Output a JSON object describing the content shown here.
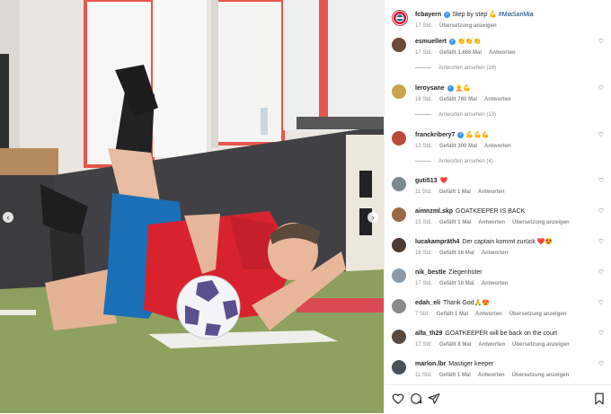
{
  "caption": {
    "username": "fcbayern",
    "text": "Step by step ",
    "emoji": "💪",
    "hashtag": "#MiaSanMia",
    "time": "17 Std.",
    "translate": "Übersetzung anzeigen"
  },
  "comments": [
    {
      "username": "esmuellert",
      "verified": true,
      "text": "",
      "emoji": "👏👏👏",
      "time": "17 Std.",
      "likes": "Gefällt 1.666 Mal",
      "reply": "Antworten",
      "translate": "",
      "replies": "Antworten ansehen (18)"
    },
    {
      "username": "leroysane",
      "verified": true,
      "text": "",
      "emoji": "🧑‍🦲💪",
      "time": "16 Std.",
      "likes": "Gefällt 760 Mal",
      "reply": "Antworten",
      "translate": "",
      "replies": "Antworten ansehen (13)"
    },
    {
      "username": "franckribery7",
      "verified": true,
      "text": "",
      "emoji": "💪💪💪",
      "time": "13 Std.",
      "likes": "Gefällt 300 Mal",
      "reply": "Antworten",
      "translate": "",
      "replies": "Antworten ansehen (4)"
    },
    {
      "username": "guti513",
      "verified": false,
      "text": "",
      "emoji": "❤️",
      "time": "11 Std.",
      "likes": "Gefällt 1 Mal",
      "reply": "Antworten",
      "translate": "",
      "replies": ""
    },
    {
      "username": "aimnzml.skp",
      "verified": false,
      "text": "GOATKEEPER IS BACK",
      "emoji": "",
      "time": "15 Std.",
      "likes": "Gefällt 1 Mal",
      "reply": "Antworten",
      "translate": "Übersetzung anzeigen",
      "replies": ""
    },
    {
      "username": "lucakampräth4",
      "verified": false,
      "text": "Der captain kommt zurück ",
      "emoji": "❤️😍",
      "time": "16 Std.",
      "likes": "Gefällt 16 Mal",
      "reply": "Antworten",
      "translate": "",
      "replies": ""
    },
    {
      "username": "nik_bestle",
      "verified": false,
      "text": "Ziegenhüter",
      "emoji": "",
      "time": "17 Std.",
      "likes": "Gefällt 10 Mal",
      "reply": "Antworten",
      "translate": "",
      "replies": ""
    },
    {
      "username": "edah_eli",
      "verified": false,
      "text": "Thank God",
      "emoji": "🙏😍",
      "time": "7 Std.",
      "likes": "Gefällt 1 Mal",
      "reply": "Antworten",
      "translate": "Übersetzung anzeigen",
      "replies": ""
    },
    {
      "username": "alfa_th29",
      "verified": false,
      "text": "GOATKEEPER will be back on the court",
      "emoji": "",
      "time": "17 Std.",
      "likes": "Gefällt 8 Mal",
      "reply": "Antworten",
      "translate": "Übersetzung anzeigen",
      "replies": ""
    },
    {
      "username": "marlon.lbr",
      "verified": false,
      "text": "Mastiger keeper",
      "emoji": "",
      "time": "11 Std.",
      "likes": "Gefällt 1 Mal",
      "reply": "Antworten",
      "translate": "Übersetzung anzeigen",
      "replies": ""
    }
  ],
  "icons": {
    "like": "heart-icon",
    "comment": "comment-icon",
    "share": "share-icon",
    "save": "bookmark-icon",
    "prev": "chevron-left-icon",
    "next": "chevron-right-icon"
  },
  "colors": {
    "link": "#00376b",
    "verified": "#3897f0",
    "muted": "#8e8e8e",
    "heart": "#ed1c46"
  }
}
